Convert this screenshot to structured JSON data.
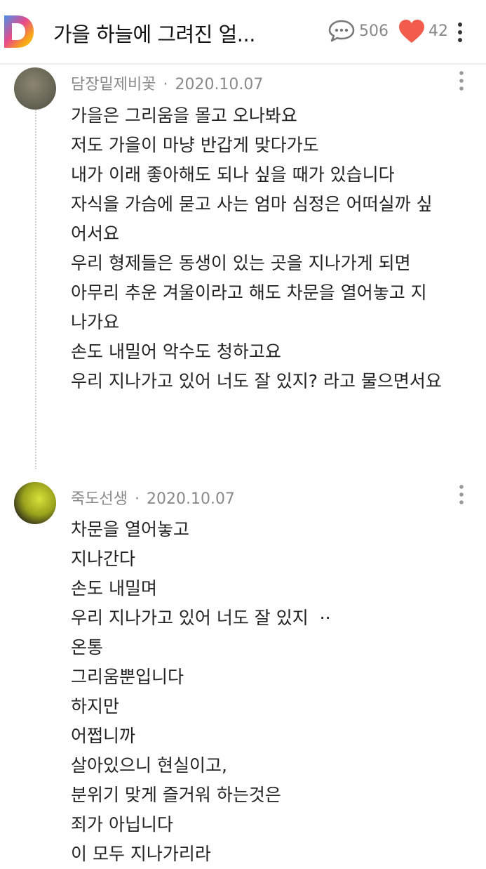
{
  "header": {
    "title": "가을 하늘에 그려진 얼...",
    "comment_count": "506",
    "like_count": "42",
    "brand_color": "#4a90e2",
    "like_color": "#f25c4c"
  },
  "comments": [
    {
      "author": "담장밑제비꽃",
      "date": "2020.10.07",
      "lines": [
        "가을은 그리움을 몰고 오나봐요",
        "저도 가을이 마냥 반갑게 맞다가도",
        "내가 이래 좋아해도 되나 싶을 때가 있습니다",
        "자식을 가슴에 묻고 사는 엄마 심정은 어떠실까 싶",
        "어서요",
        "우리 형제들은 동생이 있는 곳을 지나가게 되면",
        "아무리 추운 겨울이라고 해도 차문을 열어놓고 지",
        "나가요",
        "손도 내밀어 악수도 청하고요",
        "우리 지나가고 있어 너도 잘 있지? 라고 물으면서요"
      ]
    },
    {
      "author": "죽도선생",
      "date": "2020.10.07",
      "lines": [
        "차문을 열어놓고",
        "지나간다",
        "손도 내밀며",
        "우리 지나가고 있어 너도 잘 있지  ··",
        "온통",
        "그리움뿐입니다",
        "하지만",
        "어쩝니까",
        "살아있으니 현실이고,",
        "분위기 맞게 즐거워 하는것은",
        "죄가 아닙니다",
        "이 모두 지나가리라"
      ]
    }
  ]
}
